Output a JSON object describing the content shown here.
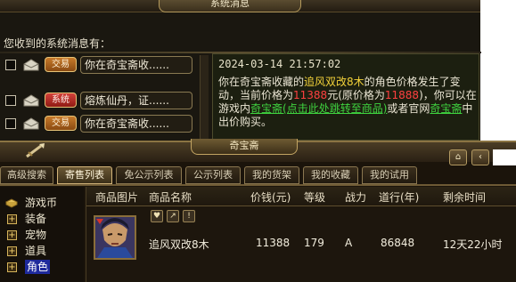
{
  "message_window": {
    "title": "系统消息",
    "prompt": "您收到的系统消息有：",
    "messages": [
      {
        "tag": "交易",
        "text": "你在奇宝斋收......"
      },
      {
        "tag": "系统",
        "text": "熔炼仙丹，证......"
      },
      {
        "tag": "交易",
        "text": "你在奇宝斋收......"
      }
    ],
    "detail": {
      "time": "2024-03-14 21:57:02",
      "p1": "你在奇宝斋收藏的",
      "item_name": "追风双改8木",
      "p2": "的角色价格发生了变动，当前价格为",
      "price_now": "11388",
      "p3": "元(原价格为",
      "price_old": "11888",
      "p4": ")，你可以在游戏内",
      "link1": "奇宝斋(点击此处跳转至商品)",
      "p5": "或者官网",
      "link2": "奇宝斋",
      "p6": "中出价购买。"
    }
  },
  "shop_window": {
    "title": "奇宝斋",
    "tool_btn_home": "⌂",
    "tool_btn_back": "‹",
    "tabs": [
      "高级搜索",
      "寄售列表",
      "免公示列表",
      "公示列表",
      "我的货架",
      "我的收藏",
      "我的试用"
    ],
    "active_tab": 1,
    "categories": [
      {
        "label": "游戏币"
      },
      {
        "label": "装备"
      },
      {
        "label": "宠物"
      },
      {
        "label": "道具"
      },
      {
        "label": "角色"
      }
    ],
    "table": {
      "headers": [
        "商品图片",
        "商品名称",
        "价钱(元)",
        "等级",
        "战力",
        "道行(年)",
        "剩余时间"
      ],
      "rows": [
        {
          "icons": [
            "♥",
            "↗",
            "!"
          ],
          "name": "追风双改8木",
          "price": "11388",
          "level": "179",
          "power": "A",
          "dao": "86848",
          "remaining": "12天22小时"
        }
      ]
    }
  }
}
